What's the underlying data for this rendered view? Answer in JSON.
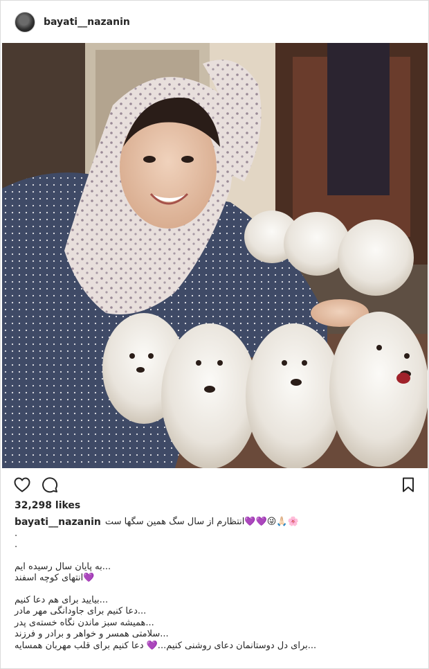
{
  "post": {
    "username": "bayati__nazanin",
    "likes_text": "32,298 likes",
    "caption": {
      "username": "bayati__nazanin",
      "first_line": "🌸🙏🏻😜💜💜انتظارم از سال سگ همین سگها ست",
      "dot_lines": [
        ".",
        "."
      ],
      "block1": [
        "...به پایان سال رسیده ایم",
        "💜انتهای کوچه اسفند"
      ],
      "block2": [
        "...بیایید برای هم دعا کنیم",
        "...دعا کنیم برای جاودانگی مهر مادر",
        "...همیشه سبز ماندن نگاه خسته‌ی پدر",
        "...سلامتی همسر و خواهر و برادر و فرزند",
        "...برای دل دوستانمان دعای روشنی کنیم...💜 دعا کنیم برای قلب مهربان همسایه"
      ]
    }
  },
  "icons": {
    "avatar": "profile-avatar",
    "like": "heart-outline-icon",
    "comment": "comment-bubble-icon",
    "save": "bookmark-icon"
  },
  "colors": {
    "text": "#262626",
    "border": "#dbdbdb",
    "heart_purple": "#a070e0"
  }
}
